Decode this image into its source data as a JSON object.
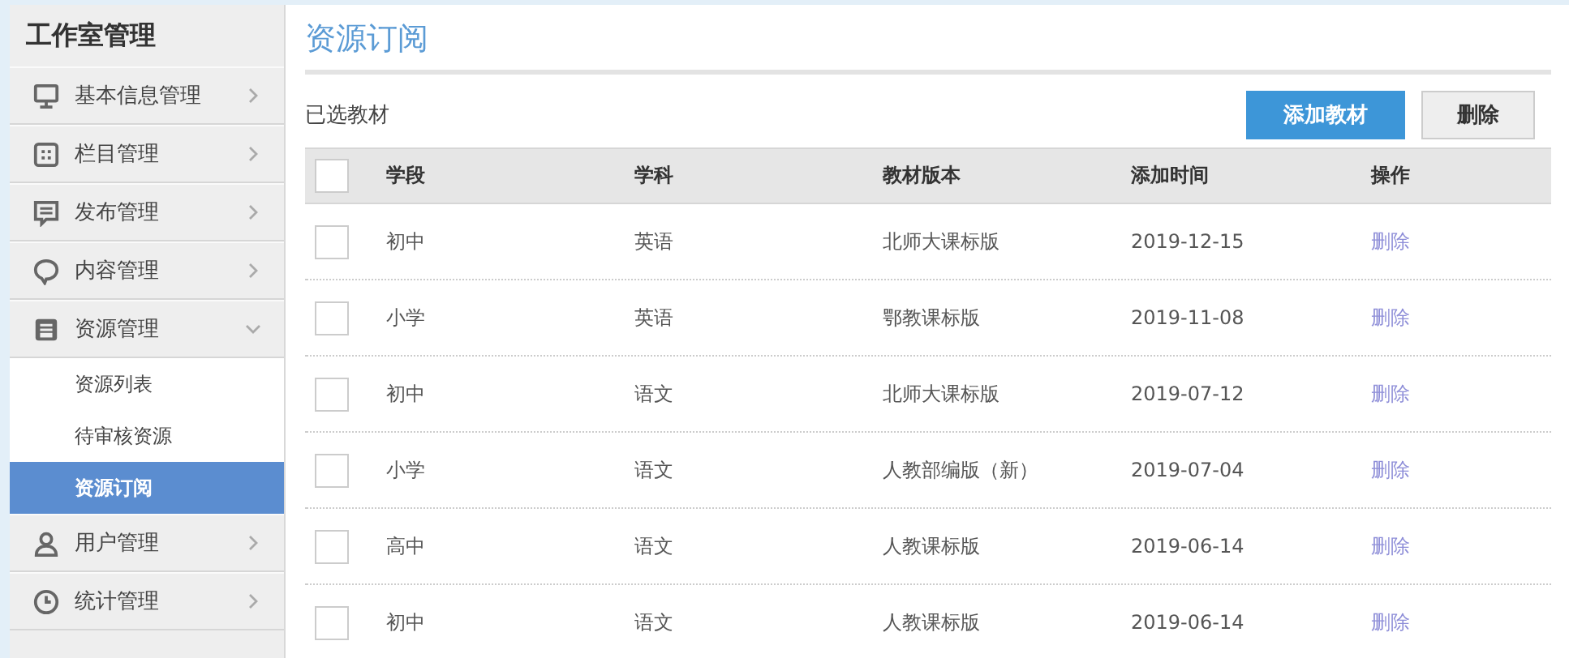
{
  "sidebar": {
    "title": "工作室管理",
    "items": [
      {
        "label": "基本信息管理",
        "expanded": false
      },
      {
        "label": "栏目管理",
        "expanded": false
      },
      {
        "label": "发布管理",
        "expanded": false
      },
      {
        "label": "内容管理",
        "expanded": false
      },
      {
        "label": "资源管理",
        "expanded": true,
        "children": [
          {
            "label": "资源列表",
            "selected": false
          },
          {
            "label": "待审核资源",
            "selected": false
          },
          {
            "label": "资源订阅",
            "selected": true
          }
        ]
      },
      {
        "label": "用户管理",
        "expanded": false
      },
      {
        "label": "统计管理",
        "expanded": false
      }
    ]
  },
  "page": {
    "title": "资源订阅",
    "subtitle": "已选教材",
    "buttons": [
      {
        "label": "添加教材",
        "kind": "primary"
      },
      {
        "label": "删除",
        "kind": "default"
      }
    ]
  },
  "table": {
    "header_checked": false,
    "columns": [
      "学段",
      "学科",
      "教材版本",
      "添加时间",
      "操作"
    ],
    "rows": [
      {
        "checked": false,
        "cells": [
          "初中",
          "英语",
          "北师大课标版",
          "2019-12-15"
        ],
        "action": "删除"
      },
      {
        "checked": false,
        "cells": [
          "小学",
          "英语",
          "鄂教课标版",
          "2019-11-08"
        ],
        "action": "删除"
      },
      {
        "checked": false,
        "cells": [
          "初中",
          "语文",
          "北师大课标版",
          "2019-07-12"
        ],
        "action": "删除"
      },
      {
        "checked": false,
        "cells": [
          "小学",
          "语文",
          "人教部编版（新）",
          "2019-07-04"
        ],
        "action": "删除"
      },
      {
        "checked": false,
        "cells": [
          "高中",
          "语文",
          "人教课标版",
          "2019-06-14"
        ],
        "action": "删除"
      },
      {
        "checked": false,
        "cells": [
          "初中",
          "语文",
          "人教课标版",
          "2019-06-14"
        ],
        "action": "删除"
      }
    ]
  }
}
